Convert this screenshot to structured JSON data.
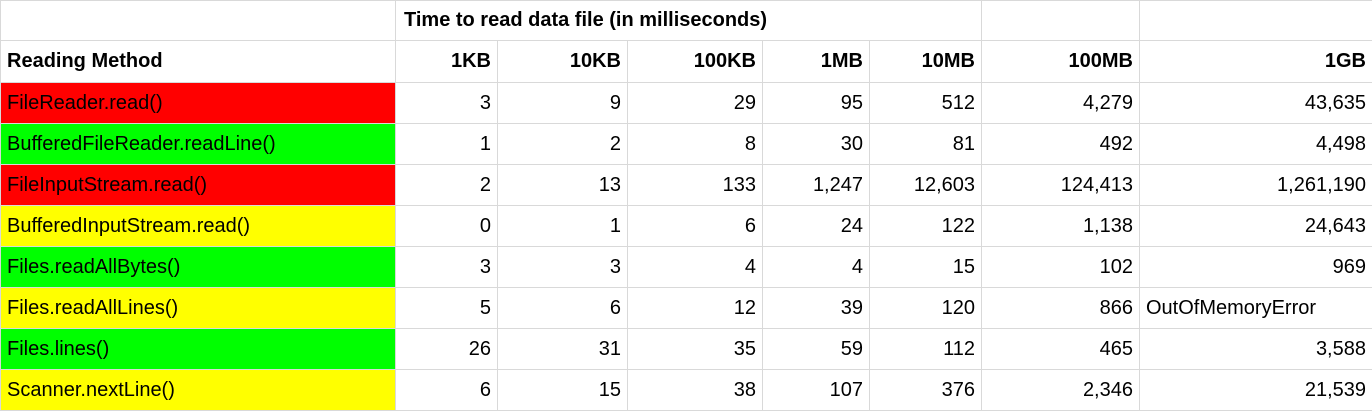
{
  "super_header": "Time to read data file (in milliseconds)",
  "columns": [
    "Reading Method",
    "1KB",
    "10KB",
    "100KB",
    "1MB",
    "10MB",
    "100MB",
    "1GB"
  ],
  "colors": {
    "red": "#ff0000",
    "green": "#00ff00",
    "yellow": "#ffff00"
  },
  "rows": [
    {
      "method": "FileReader.read()",
      "color": "red",
      "values": [
        "3",
        "9",
        "29",
        "95",
        "512",
        "4,279",
        "43,635"
      ]
    },
    {
      "method": "BufferedFileReader.readLine()",
      "color": "green",
      "values": [
        "1",
        "2",
        "8",
        "30",
        "81",
        "492",
        "4,498"
      ]
    },
    {
      "method": "FileInputStream.read()",
      "color": "red",
      "values": [
        "2",
        "13",
        "133",
        "1,247",
        "12,603",
        "124,413",
        "1,261,190"
      ]
    },
    {
      "method": "BufferedInputStream.read()",
      "color": "yellow",
      "values": [
        "0",
        "1",
        "6",
        "24",
        "122",
        "1,138",
        "24,643"
      ]
    },
    {
      "method": "Files.readAllBytes()",
      "color": "green",
      "values": [
        "3",
        "3",
        "4",
        "4",
        "15",
        "102",
        "969"
      ]
    },
    {
      "method": "Files.readAllLines()",
      "color": "yellow",
      "values": [
        "5",
        "6",
        "12",
        "39",
        "120",
        "866",
        "OutOfMemoryError"
      ]
    },
    {
      "method": "Files.lines()",
      "color": "green",
      "values": [
        "26",
        "31",
        "35",
        "59",
        "112",
        "465",
        "3,588"
      ]
    },
    {
      "method": "Scanner.nextLine()",
      "color": "yellow",
      "values": [
        "6",
        "15",
        "38",
        "107",
        "376",
        "2,346",
        "21,539"
      ]
    }
  ]
}
